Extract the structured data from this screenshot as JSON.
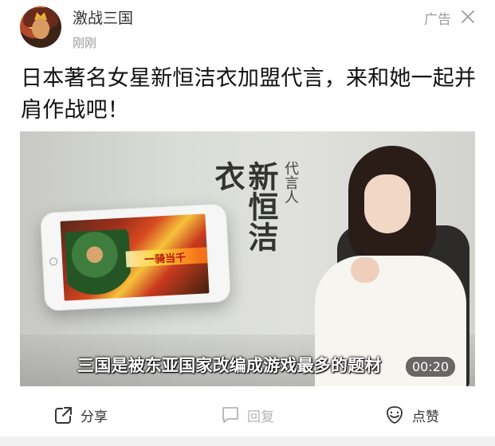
{
  "post": {
    "account_name": "激战三国",
    "time": "刚刚",
    "ad_label": "广告",
    "title": "日本著名女星新恒洁衣加盟代言，来和她一起并肩作战吧！"
  },
  "video": {
    "spokesperson_name": "新恒洁衣",
    "spokesperson_label": "代言人",
    "game_skill_text": "一骑当千",
    "subtitle": "三国是被东亚国家改编成游戏最多的题材",
    "duration": "00:20"
  },
  "actions": {
    "share": "分享",
    "reply": "回复",
    "like": "点赞"
  }
}
